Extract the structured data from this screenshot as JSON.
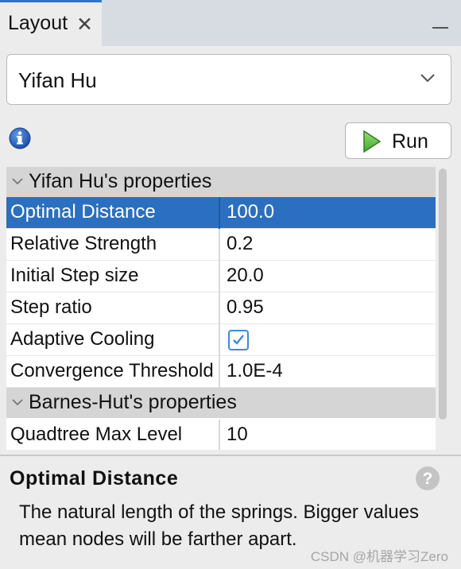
{
  "panel": {
    "tab_label": "Layout",
    "close_glyph": "✕"
  },
  "algorithm": {
    "selected": "Yifan Hu"
  },
  "toolbar": {
    "run_label": "Run"
  },
  "sections": [
    {
      "label": "Yifan Hu's properties"
    },
    {
      "label": "Barnes-Hut's properties"
    }
  ],
  "properties": [
    {
      "name": "Optimal Distance",
      "value": "100.0",
      "selected": true
    },
    {
      "name": "Relative Strength",
      "value": "0.2"
    },
    {
      "name": "Initial Step size",
      "value": "20.0"
    },
    {
      "name": "Step ratio",
      "value": "0.95"
    },
    {
      "name": "Adaptive Cooling",
      "value": "",
      "checked": true
    },
    {
      "name": "Convergence Threshold",
      "value": "1.0E-4"
    },
    {
      "name": "Quadtree Max Level",
      "value": "10"
    }
  ],
  "description": {
    "title": "Optimal Distance",
    "text": "The natural length of the springs. Bigger values mean nodes will be farther apart."
  },
  "watermark": "CSDN @机器学习Zero",
  "colors": {
    "selection": "#2b6fc0",
    "tab_accent": "#2f73c9",
    "checkbox": "#3a8ce0"
  },
  "icons": {
    "info": "info-icon",
    "run": "play-icon",
    "help": "help-icon",
    "dropdown": "chevron-down-icon"
  }
}
